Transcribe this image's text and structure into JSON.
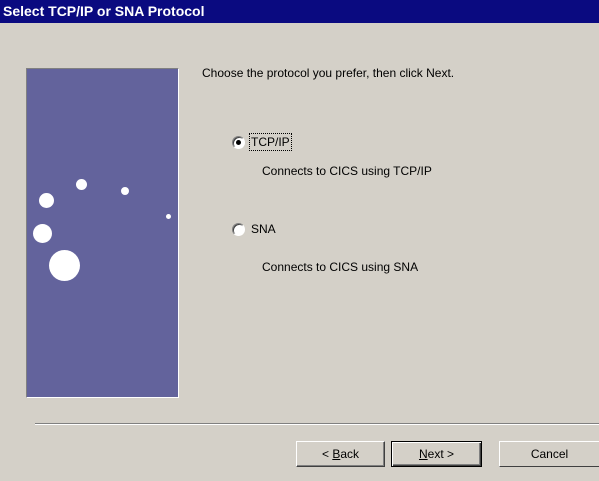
{
  "window": {
    "title": "Select TCP/IP or SNA Protocol"
  },
  "main": {
    "instruction": "Choose the protocol you prefer, then click Next.",
    "options": [
      {
        "label": "TCP/IP",
        "description": "Connects to CICS using TCP/IP",
        "selected": true
      },
      {
        "label": "SNA",
        "description": "Connects to CICS using SNA",
        "selected": false
      }
    ]
  },
  "buttons": {
    "back_prefix": "< ",
    "back_accel": "B",
    "back_rest": "ack",
    "next_accel": "N",
    "next_rest": "ext >",
    "cancel": "Cancel"
  },
  "colors": {
    "title_bar": "#0a0a80",
    "dialog_bg": "#d4d0c8",
    "side_panel": "#63639c"
  }
}
